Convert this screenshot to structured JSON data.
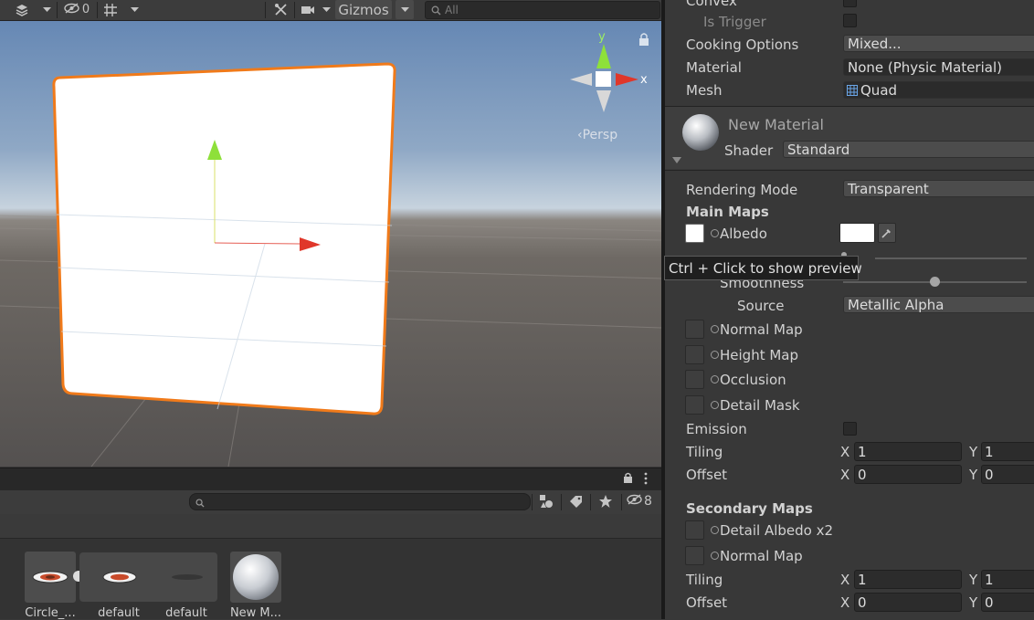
{
  "scene_toolbar": {
    "hidden_count": "0",
    "gizmos_label": "Gizmos",
    "search_placeholder": "All"
  },
  "scene_view": {
    "gizmo_y_label": "y",
    "gizmo_x_label": "x",
    "projection_label": "Persp"
  },
  "project_panel": {
    "hidden_count": "8",
    "assets": [
      {
        "label": "Circle_..."
      },
      {
        "label": "default"
      },
      {
        "label": "default"
      },
      {
        "label": "New M..."
      }
    ]
  },
  "inspector": {
    "collider": {
      "convex_label": "Convex",
      "is_trigger_label": "Is Trigger",
      "cooking_options_label": "Cooking Options",
      "cooking_options_value": "Mixed...",
      "material_label": "Material",
      "material_value": "None (Physic Material)",
      "mesh_label": "Mesh",
      "mesh_value": "Quad"
    },
    "material_header": {
      "name": "New Material",
      "shader_label": "Shader",
      "shader_value": "Standard"
    },
    "rendering_mode_label": "Rendering Mode",
    "rendering_mode_value": "Transparent",
    "main_maps_title": "Main Maps",
    "albedo_label": "Albedo",
    "tooltip_text": "Ctrl + Click to show preview",
    "smoothness_label": "Smoothness",
    "smoothness_value": 0.5,
    "source_label": "Source",
    "source_value": "Metallic Alpha",
    "normal_map_label": "Normal Map",
    "height_map_label": "Height Map",
    "occlusion_label": "Occlusion",
    "detail_mask_label": "Detail Mask",
    "emission_label": "Emission",
    "tiling_label": "Tiling",
    "offset_label": "Offset",
    "x_label": "X",
    "y_label": "Y",
    "main_tiling": {
      "x": "1",
      "y": "1"
    },
    "main_offset": {
      "x": "0",
      "y": "0"
    },
    "secondary_maps_title": "Secondary Maps",
    "detail_albedo_label": "Detail Albedo x2",
    "secondary_normal_label": "Normal Map",
    "secondary_tiling": {
      "x": "1",
      "y": "1"
    },
    "secondary_offset": {
      "x": "0",
      "y": "0"
    }
  },
  "colors": {
    "selection_outline": "#f07a1a",
    "axis_x": "#e0372a",
    "axis_y": "#8ee03a",
    "panel_bg": "#383838"
  },
  "icons": [
    "layers-icon",
    "visibility-icon",
    "grid-icon",
    "tools-icon",
    "camera-icon",
    "search-icon",
    "lock-icon",
    "menu-dots-icon",
    "filter-icon",
    "label-icon",
    "star-icon",
    "eyedropper-icon",
    "mesh-icon",
    "sphere-preview-icon"
  ]
}
